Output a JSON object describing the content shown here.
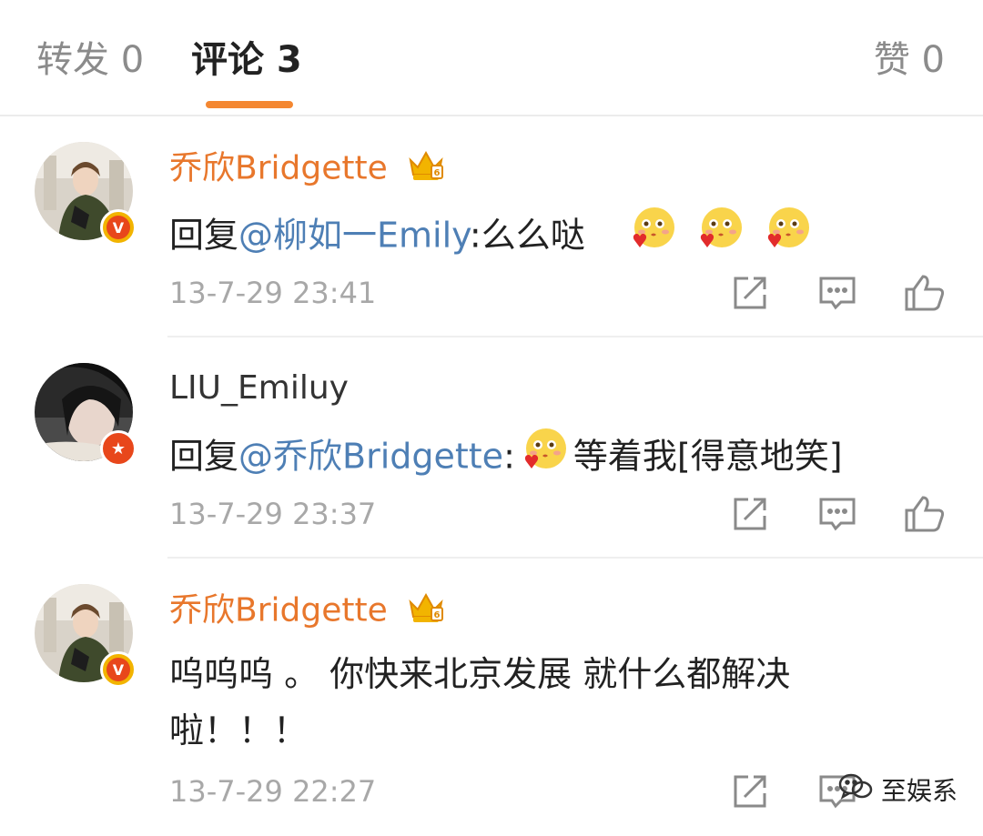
{
  "tabs": {
    "repost": "转发 0",
    "comments": "评论 3",
    "likes": "赞 0"
  },
  "comments": [
    {
      "user": "乔欣Bridgette",
      "text_prefix": "回复",
      "mention": "@柳如一Emily",
      "text_suffix": ":么么哒",
      "emojis": [
        "kiss-emoji",
        "kiss-emoji",
        "kiss-emoji"
      ],
      "time": "13-7-29 23:41",
      "badge": "V"
    },
    {
      "user": "LIU_Emiluy",
      "text_prefix": "回复",
      "mention": "@乔欣Bridgette",
      "text_suffix": ":",
      "text_after_emoji": "等着我[得意地笑]",
      "emojis": [
        "kiss-emoji"
      ],
      "time": "13-7-29 23:37",
      "badge": "★"
    },
    {
      "user": "乔欣Bridgette",
      "line1": "呜呜呜 。 你快来北京发展 就什么都解决",
      "line2": "啦！！！",
      "time": "13-7-29 22:27",
      "badge": "V"
    }
  ],
  "watermark": "至娱系",
  "colors": {
    "accent": "#f48731",
    "username_vip": "#e8772c",
    "mention": "#4e7fb5",
    "timestamp": "#a8a8a8"
  }
}
